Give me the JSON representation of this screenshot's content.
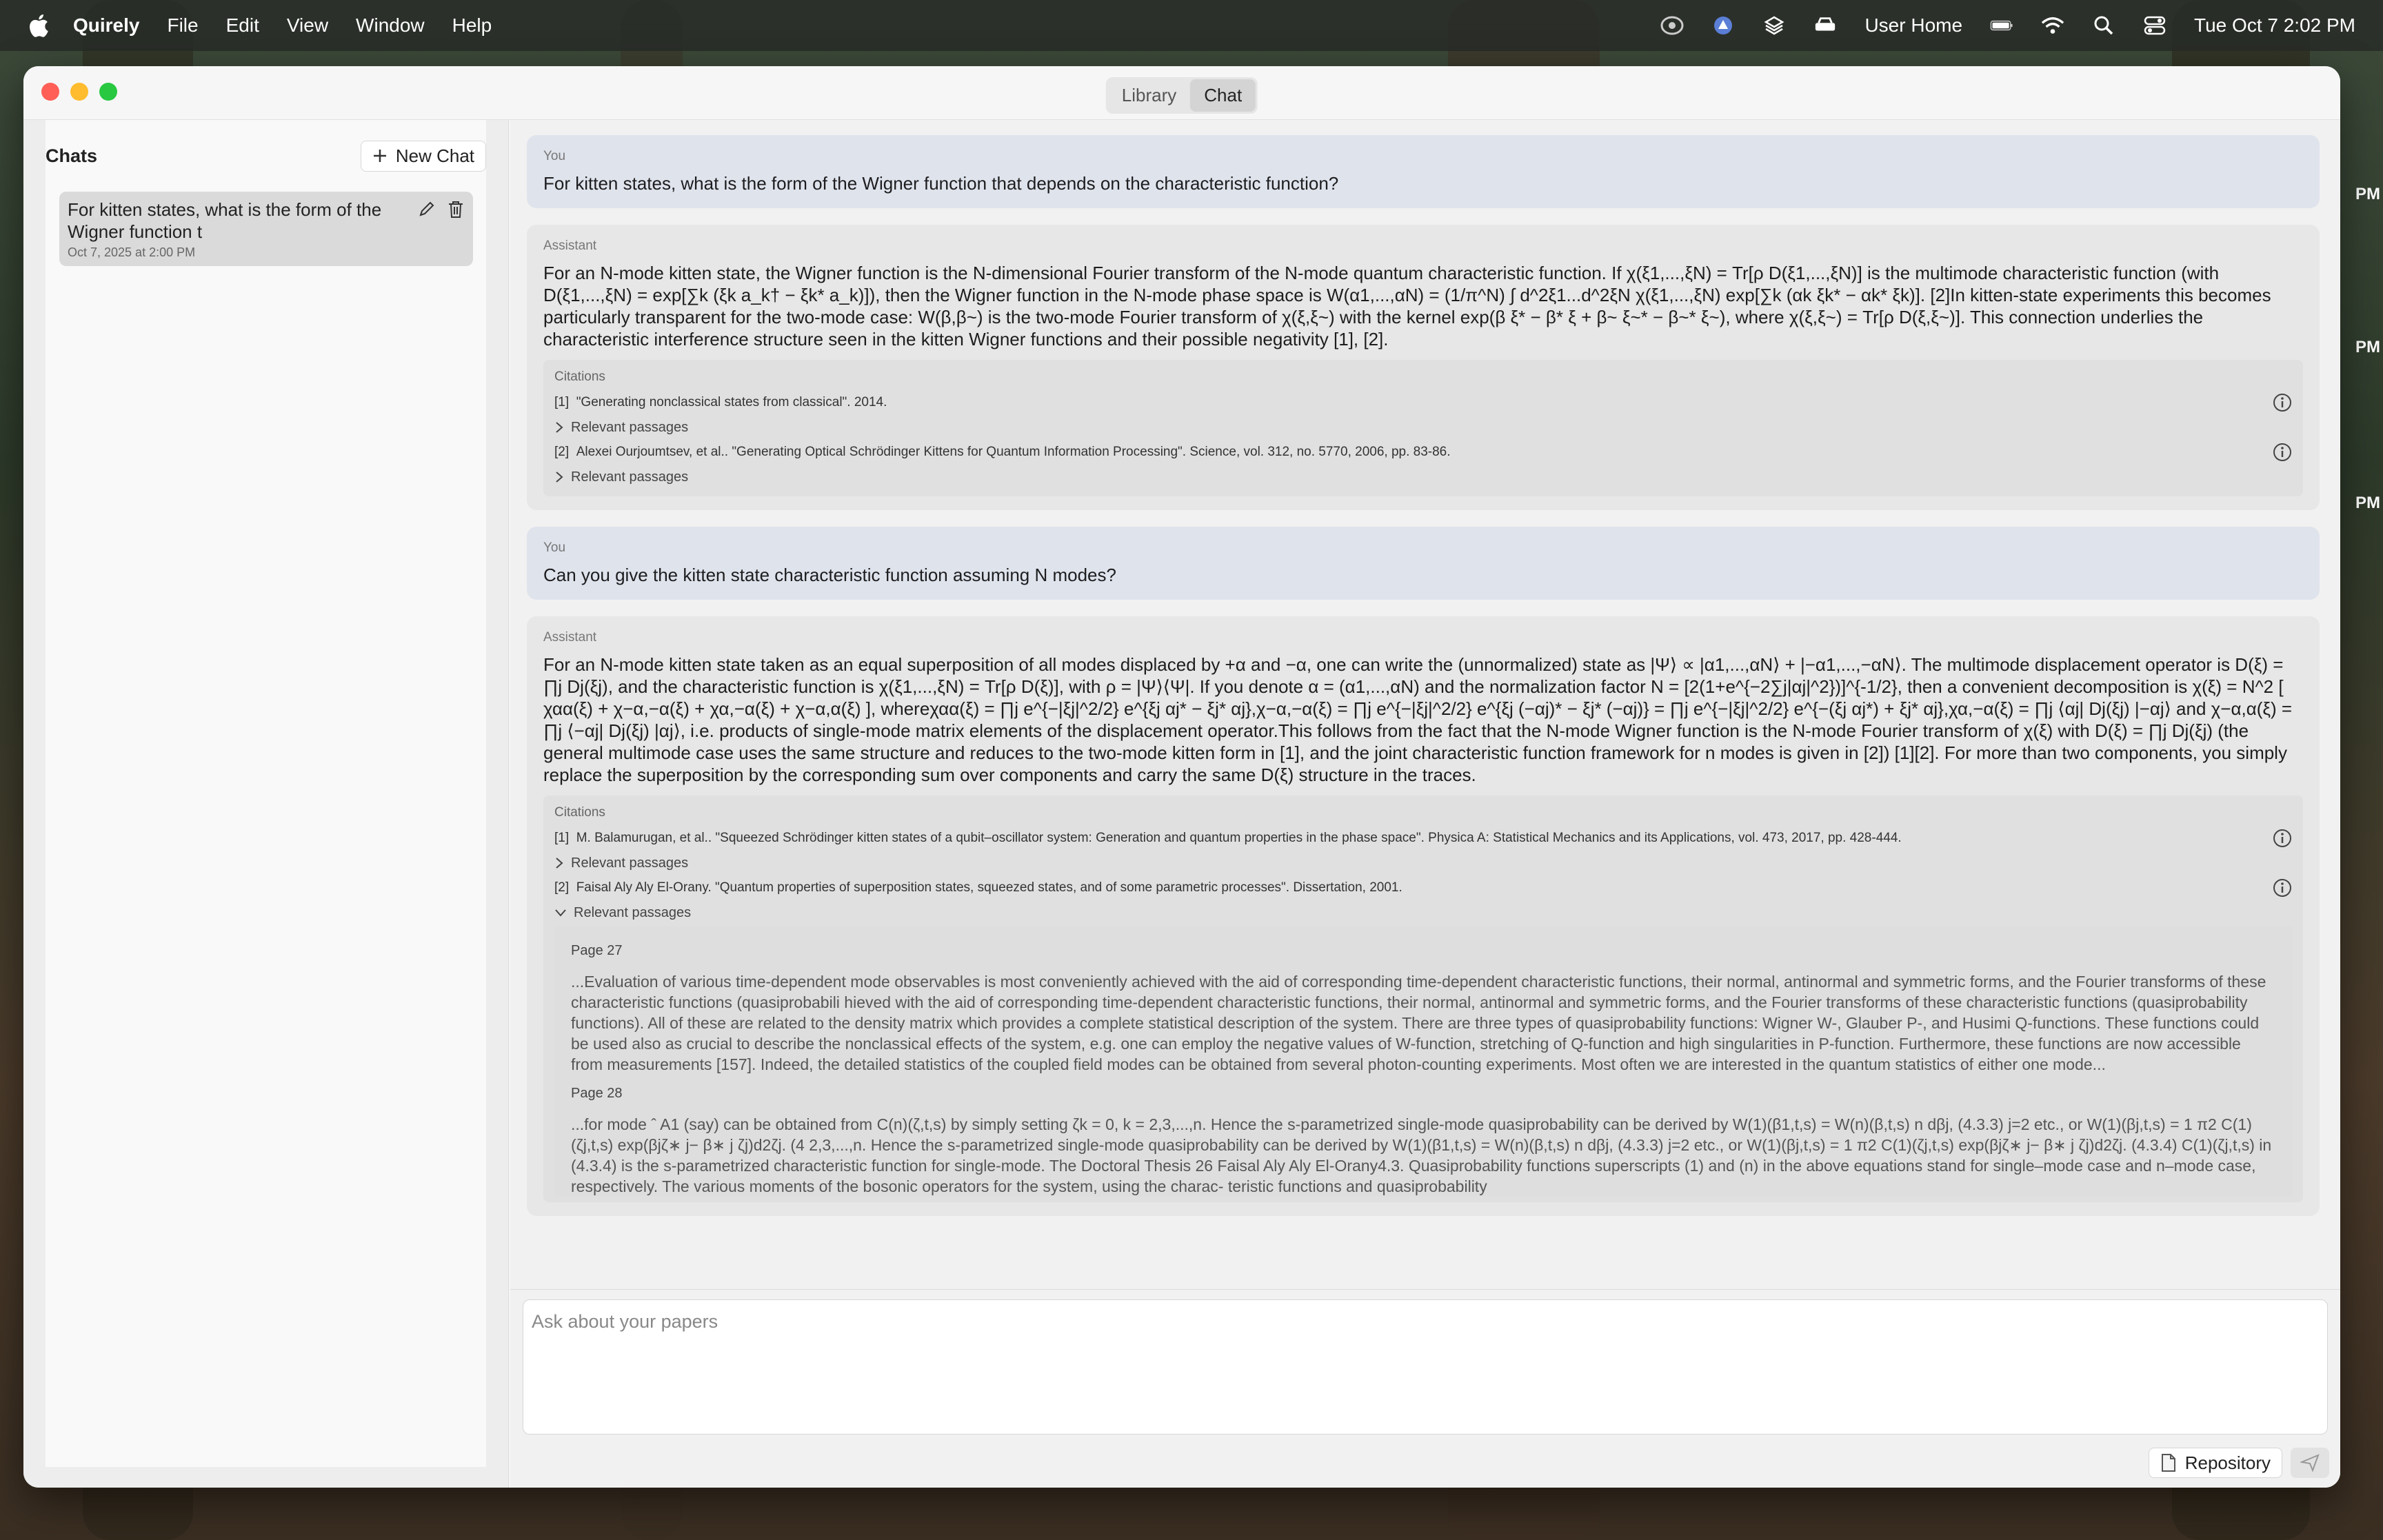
{
  "menubar": {
    "app_name": "Quirely",
    "items": [
      "File",
      "Edit",
      "View",
      "Window",
      "Help"
    ],
    "user_label": "User Home",
    "datetime": "Tue Oct 7  2:02 PM"
  },
  "window": {
    "tabs": [
      {
        "label": "Library",
        "active": false
      },
      {
        "label": "Chat",
        "active": true
      }
    ]
  },
  "sidebar": {
    "title": "Chats",
    "new_chat_label": "New Chat",
    "chats": [
      {
        "title": "For kitten states, what is the form of the Wigner function t",
        "date": "Oct 7, 2025 at 2:00 PM"
      }
    ]
  },
  "conversation": {
    "messages": [
      {
        "role": "You",
        "type": "user",
        "text": "For kitten states, what is the form of the Wigner function that depends on the characteristic function?"
      },
      {
        "role": "Assistant",
        "type": "assistant",
        "text": "For an N-mode kitten state, the Wigner function is the N-dimensional Fourier transform of the N-mode quantum characteristic function. If χ(ξ1,...,ξN) = Tr[ρ D(ξ1,...,ξN)] is the multimode characteristic function (with D(ξ1,...,ξN) = exp[∑k (ξk a_k† − ξk* a_k)]), then the Wigner function in the N-mode phase space is W(α1,...,αN) = (1/π^N) ∫ d^2ξ1...d^2ξN χ(ξ1,...,ξN) exp[∑k (αk ξk* − αk* ξk)]. [2]In kitten-state experiments this becomes particularly transparent for the two-mode case: W(β,β~) is the two-mode Fourier transform of χ(ξ,ξ~) with the kernel exp(β ξ* − β* ξ + β~ ξ~* − β~* ξ~), where χ(ξ,ξ~) = Tr[ρ D(ξ,ξ~)]. This connection underlies the characteristic interference structure seen in the kitten Wigner functions and their possible negativity [1], [2].",
        "citations_label": "Citations",
        "citations": [
          {
            "num": "[1]",
            "text": "\"Generating nonclassical states from classical\". 2014.",
            "relevant_label": "Relevant passages",
            "expanded": false
          },
          {
            "num": "[2]",
            "text": "Alexei Ourjoumtsev, et al.. \"Generating Optical Schrödinger Kittens for Quantum Information Processing\". Science, vol. 312, no. 5770, 2006, pp. 83-86.",
            "relevant_label": "Relevant passages",
            "expanded": false
          }
        ]
      },
      {
        "role": "You",
        "type": "user",
        "text": "Can you give the kitten state characteristic function assuming N modes?"
      },
      {
        "role": "Assistant",
        "type": "assistant",
        "text": "For an N-mode kitten state taken as an equal superposition of all modes displaced by +α and −α, one can write the (unnormalized) state as |Ψ⟩ ∝ |α1,...,αN⟩ + |−α1,...,−αN⟩. The multimode displacement operator is D(ξ) = ∏j Dj(ξj), and the characteristic function is χ(ξ1,...,ξN) = Tr[ρ D(ξ)], with ρ = |Ψ⟩⟨Ψ|. If you denote α = (α1,...,αN) and the normalization factor N = [2(1+e^{−2∑j|αj|^2})]^{-1/2}, then a convenient decomposition is χ(ξ) = N^2 [ χαα(ξ) + χ−α,−α(ξ) + χα,−α(ξ) + χ−α,α(ξ) ], whereχαα(ξ) = ∏j e^{−|ξj|^2/2} e^{ξj αj* − ξj* αj},χ−α,−α(ξ) = ∏j e^{−|ξj|^2/2} e^{ξj (−αj)* − ξj* (−αj)} = ∏j e^{−|ξj|^2/2} e^{−(ξj αj*) + ξj* αj},χα,−α(ξ) = ∏j ⟨αj| Dj(ξj) |−αj⟩ and χ−α,α(ξ) = ∏j ⟨−αj| Dj(ξj) |αj⟩, i.e. products of single-mode matrix elements of the displacement operator.This follows from the fact that the N-mode Wigner function is the N-mode Fourier transform of χ(ξ) with D(ξ) = ∏j Dj(ξj) (the general multimode case uses the same structure and reduces to the two-mode kitten form in [1], and the joint characteristic function framework for n modes is given in [2]) [1][2]. For more than two components, you simply replace the superposition by the corresponding sum over components and carry the same D(ξ) structure in the traces.",
        "citations_label": "Citations",
        "citations": [
          {
            "num": "[1]",
            "text": "M. Balamurugan, et al.. \"Squeezed Schrödinger kitten states of a qubit–oscillator system: Generation and quantum properties in the phase space\". Physica A: Statistical Mechanics and its Applications, vol. 473, 2017, pp. 428-444.",
            "relevant_label": "Relevant passages",
            "expanded": false
          },
          {
            "num": "[2]",
            "text": "Faisal Aly Aly El-Orany. \"Quantum properties of superposition states, squeezed states, and of some parametric processes\". Dissertation, 2001.",
            "relevant_label": "Relevant passages",
            "expanded": true,
            "passages": [
              {
                "page": "Page 27",
                "text": "...Evaluation of various time-dependent mode observables is most conveniently achieved with the aid of corresponding time-dependent characteristic functions, their normal, antinormal and symmetric forms, and the Fourier transforms of these characteristic functions (quasiprobabili hieved with the aid of corresponding time-dependent characteristic functions, their normal, antinormal and symmetric forms, and the Fourier transforms of these characteristic functions (quasiprobability functions). All of these are related to the density matrix which provides a complete statistical description of the system. There are three types of quasiprobability functions: Wigner W-, Glauber P-, and Husimi Q-functions. These functions could be used also as crucial to describe the nonclassical effects of the system, e.g. one can employ the negative values of W-function, stretching of Q-function and high singularities in P-function. Furthermore, these functions are now accessible from measurements [157]. Indeed, the detailed statistics of the coupled field modes can be obtained from several photon-counting experiments. Most often we are interested in the quantum statistics of either one mode..."
              },
              {
                "page": "Page 28",
                "text": "...for mode ˆ A1 (say) can be obtained from C(n)(ζ,t,s) by simply setting ζk = 0, k = 2,3,...,n. Hence the s-parametrized single-mode quasiprobability can be derived by W(1)(β1,t,s) = W(n)(β,t,s) n dβj, (4.3.3) j=2 etc., or W(1)(βj,t,s) = 1 π2 C(1)(ζj,t,s) exp(βjζ∗ j− β∗ j ζj)d2ζj. (4 2,3,...,n. Hence the s-parametrized single-mode quasiprobability can be derived by W(1)(β1,t,s) = W(n)(β,t,s) n dβj, (4.3.3) j=2 etc., or W(1)(βj,t,s) = 1 π2 C(1)(ζj,t,s) exp(βjζ∗ j− β∗ j ζj)d2ζj. (4.3.4) C(1)(ζj,t,s) in (4.3.4) is the s-parametrized characteristic function for single-mode. The Doctoral Thesis 26 Faisal Aly Aly El-Orany4.3. Quasiprobability functions superscripts (1) and (n) in the above equations stand for single–mode case and n–mode case, respectively. The various moments of the bosonic operators for the system, using the charac- teristic functions and quasiprobability"
              }
            ]
          }
        ]
      }
    ]
  },
  "input": {
    "placeholder": "Ask about your papers",
    "repository_label": "Repository"
  },
  "edge_times": [
    "PM",
    "PM",
    "PM"
  ]
}
